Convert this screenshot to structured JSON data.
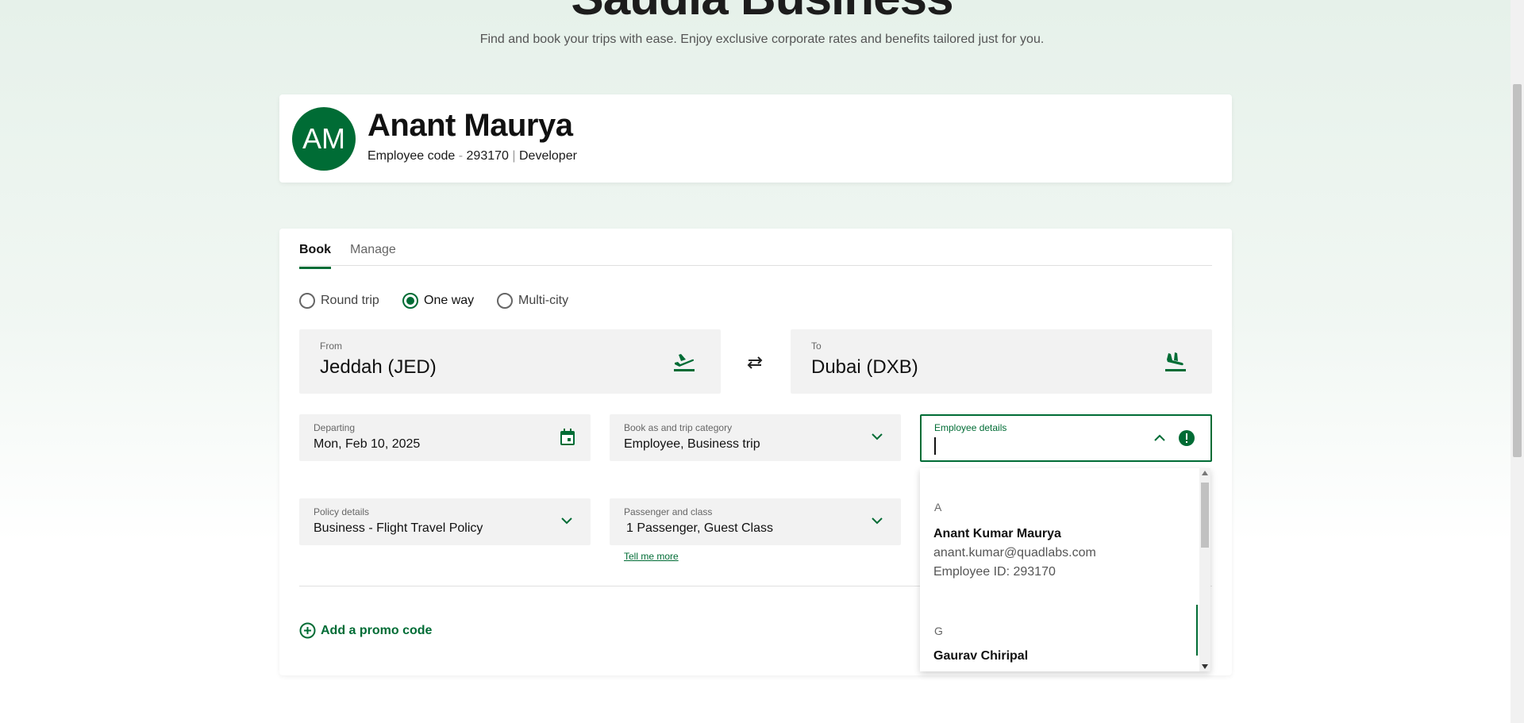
{
  "hero": {
    "title": "Saudia Business",
    "subtitle": "Find and book your trips with ease. Enjoy exclusive corporate rates and benefits tailored just for you."
  },
  "profile": {
    "initials": "AM",
    "name": "Anant Maurya",
    "employee_code_label": "Employee code",
    "employee_code_sep": "-",
    "employee_code": "293170",
    "role_sep": "|",
    "role": "Developer"
  },
  "tabs": [
    {
      "label": "Book",
      "active": true
    },
    {
      "label": "Manage",
      "active": false
    }
  ],
  "trip_types": [
    {
      "label": "Round trip",
      "checked": false
    },
    {
      "label": "One way",
      "checked": true
    },
    {
      "label": "Multi-city",
      "checked": false
    }
  ],
  "from": {
    "label": "From",
    "value": "Jeddah (JED)",
    "icon": "plane-takeoff-icon"
  },
  "to": {
    "label": "To",
    "value": "Dubai (DXB)",
    "icon": "plane-landing-icon"
  },
  "departing": {
    "label": "Departing",
    "value": "Mon, Feb 10, 2025",
    "icon": "calendar-icon"
  },
  "book_as": {
    "label": "Book as and trip category",
    "value": "Employee, Business trip"
  },
  "employee_details": {
    "label": "Employee details",
    "value": ""
  },
  "policy": {
    "label": "Policy details",
    "value": "Business - Flight Travel Policy"
  },
  "passenger": {
    "label": "Passenger and class",
    "value": "1 Passenger, Guest Class",
    "help_link": "Tell me more"
  },
  "promo": {
    "label": "Add a promo code"
  },
  "employee_list": [
    {
      "letter": "A",
      "name": "Anant Kumar Maurya",
      "email": "anant.kumar@quadlabs.com",
      "employee_id": "Employee ID: 293170"
    },
    {
      "letter": "G",
      "name": "Gaurav Chiripal"
    }
  ],
  "colors": {
    "brand": "#006c35",
    "field_bg": "#f2f2f2"
  }
}
